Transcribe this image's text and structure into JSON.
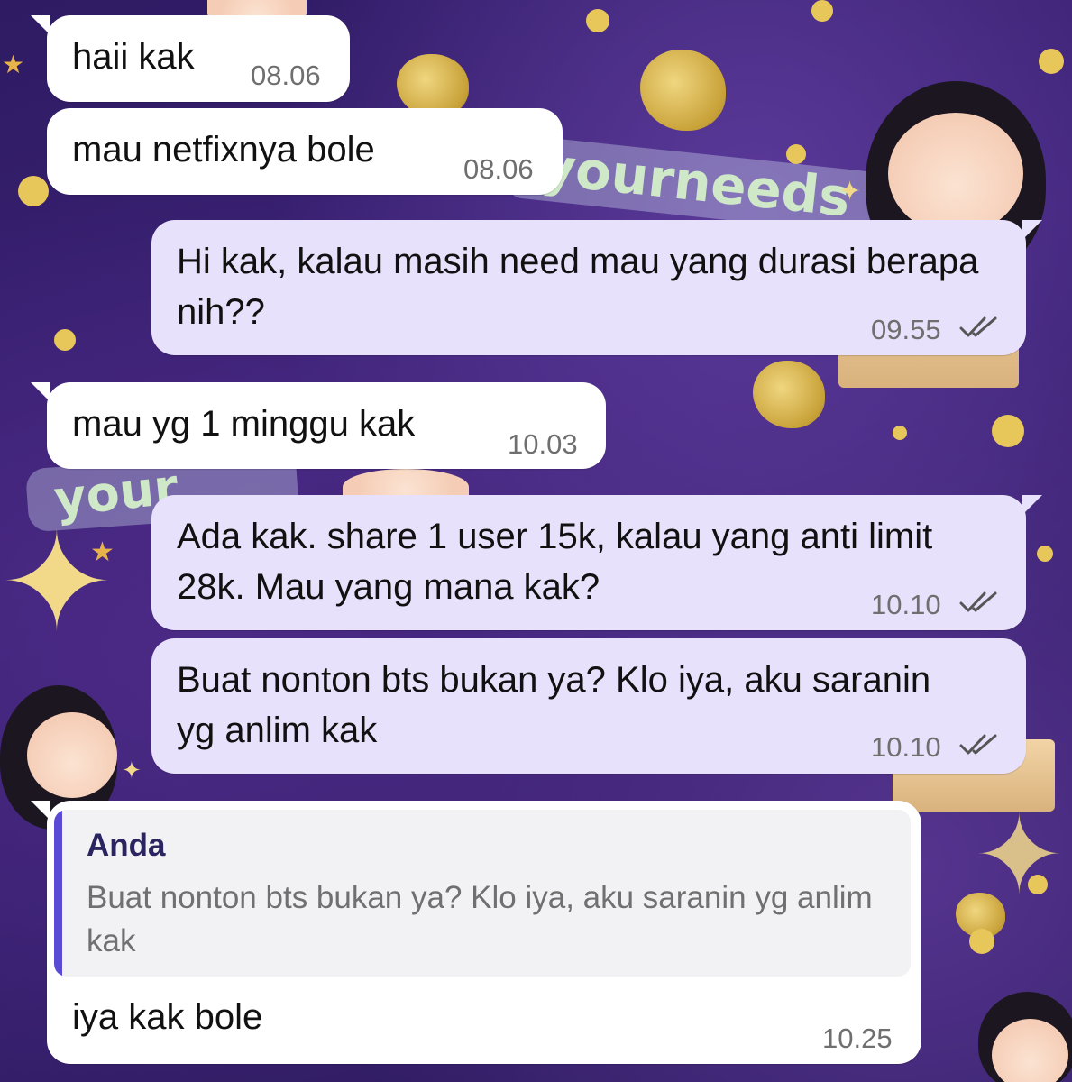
{
  "messages": [
    {
      "direction": "incoming",
      "text": "haii kak",
      "time": "08.06"
    },
    {
      "direction": "incoming",
      "text": "mau netfixnya bole",
      "time": "08.06"
    },
    {
      "direction": "outgoing",
      "text": "Hi kak, kalau masih need mau yang durasi berapa nih??",
      "time": "09.55",
      "status": "read"
    },
    {
      "direction": "incoming",
      "text": "mau yg 1 minggu kak",
      "time": "10.03"
    },
    {
      "direction": "outgoing",
      "text": "Ada kak. share 1 user 15k, kalau yang anti limit 28k. Mau yang mana kak?",
      "time": "10.10",
      "status": "read"
    },
    {
      "direction": "outgoing",
      "text": "Buat nonton bts bukan ya? Klo iya, aku saranin yg anlim kak",
      "time": "10.10",
      "status": "read"
    },
    {
      "direction": "incoming",
      "text": "iya kak bole",
      "time": "10.25",
      "reply_to": {
        "sender": "Anda",
        "text": "Buat nonton bts bukan ya? Klo iya, aku saranin yg anlim kak"
      }
    }
  ],
  "colors": {
    "incoming_bubble": "#ffffff",
    "outgoing_bubble": "#e7e1fb",
    "read_ticks": "#555555",
    "quote_bar": "#5b4ad6",
    "quote_sender": "#2a2560"
  },
  "icons": {
    "read_status": "double-check-icon"
  },
  "wallpaper": {
    "text_fragments": [
      "yourneeds",
      "your"
    ]
  }
}
